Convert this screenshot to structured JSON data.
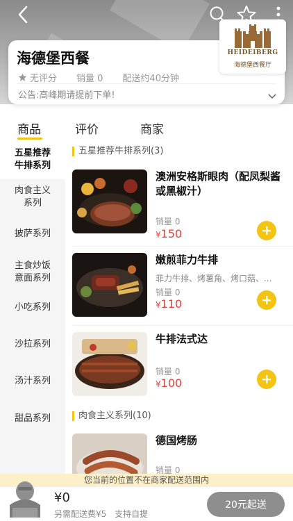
{
  "shop": {
    "name": "海德堡西餐",
    "rating": "无评分",
    "sales": "销量 0",
    "delivery_time": "配送约40分钟",
    "notice": "公告:高峰期请提前下单!",
    "logo_en": "HEIDEIBERG",
    "logo_cn": "海德堡西餐厅"
  },
  "tabs": [
    {
      "label": "商品"
    },
    {
      "label": "评价"
    },
    {
      "label": "商家"
    }
  ],
  "sidebar": {
    "items": [
      {
        "label": "五星推荐\n牛排系列"
      },
      {
        "label": "肉食主义\n系列"
      },
      {
        "label": "披萨系列"
      },
      {
        "label": "主食炒饭\n意面系列"
      },
      {
        "label": "小吃系列"
      },
      {
        "label": "沙拉系列"
      },
      {
        "label": "汤汁系列"
      },
      {
        "label": "甜品系列"
      }
    ]
  },
  "sections": [
    {
      "title": "五星推荐牛排系列(3)",
      "items": [
        {
          "name": "澳洲安格斯眼肉（配凤梨酱或黑椒汁）",
          "desc": "",
          "sales": "销量 0",
          "price_symbol": "¥",
          "price": "150"
        },
        {
          "name": "嫩煎菲力牛排",
          "desc": "菲力牛排、烤薯角、烤口菇、...",
          "sales": "销量 0",
          "price_symbol": "¥",
          "price": "110"
        },
        {
          "name": "牛排法式达",
          "desc": "",
          "sales": "销量 0",
          "price_symbol": "¥",
          "price": "100"
        }
      ]
    },
    {
      "title": "肉食主义系列(10)",
      "items": [
        {
          "name": "德国烤肠",
          "desc": "",
          "sales": "销量 0",
          "price_symbol": "¥",
          "price": ""
        }
      ]
    }
  ],
  "range_notice": "您当前的位置不在商家配送范围内",
  "cart": {
    "amount": "¥0",
    "delivery_fee": "另需配送费¥5",
    "pickup": "支持自提",
    "submit_label": "20元起送"
  },
  "colors": {
    "accent": "#f3c316",
    "price": "#e0413b",
    "submit_disabled": "#8e8e8e"
  }
}
